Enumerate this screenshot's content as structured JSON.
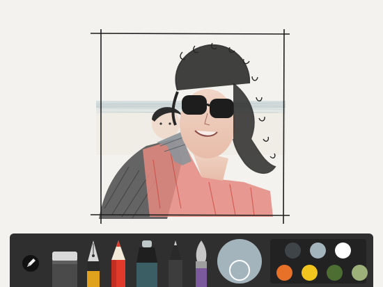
{
  "toolbar": {
    "tools": [
      {
        "id": "sketch-tools-menu",
        "icon": "pencil-circle-icon"
      },
      {
        "id": "eraser",
        "icon": "eraser-icon"
      },
      {
        "id": "fountain-pen",
        "icon": "fountain-pen-icon"
      },
      {
        "id": "pencil",
        "icon": "pencil-icon"
      },
      {
        "id": "marker",
        "icon": "marker-icon"
      },
      {
        "id": "outliner",
        "icon": "outliner-icon"
      },
      {
        "id": "brush",
        "icon": "brush-icon"
      }
    ],
    "mixer": {
      "color": "#a4b4bc"
    },
    "palette": {
      "colors": [
        "#3f4448",
        "#a4b4bc",
        "#ffffff",
        "#e8712a",
        "#f2c51e",
        "#4d6e33",
        "#9eb07a"
      ]
    }
  },
  "colors": {
    "background": "#f3f2ee",
    "toolbar": "#2f2f30",
    "frame_line": "#1e1e1e",
    "pencil_tip": "#e23a2a",
    "marker_tip": "#3b5d64",
    "brush_tip": "#7a5a9c"
  }
}
